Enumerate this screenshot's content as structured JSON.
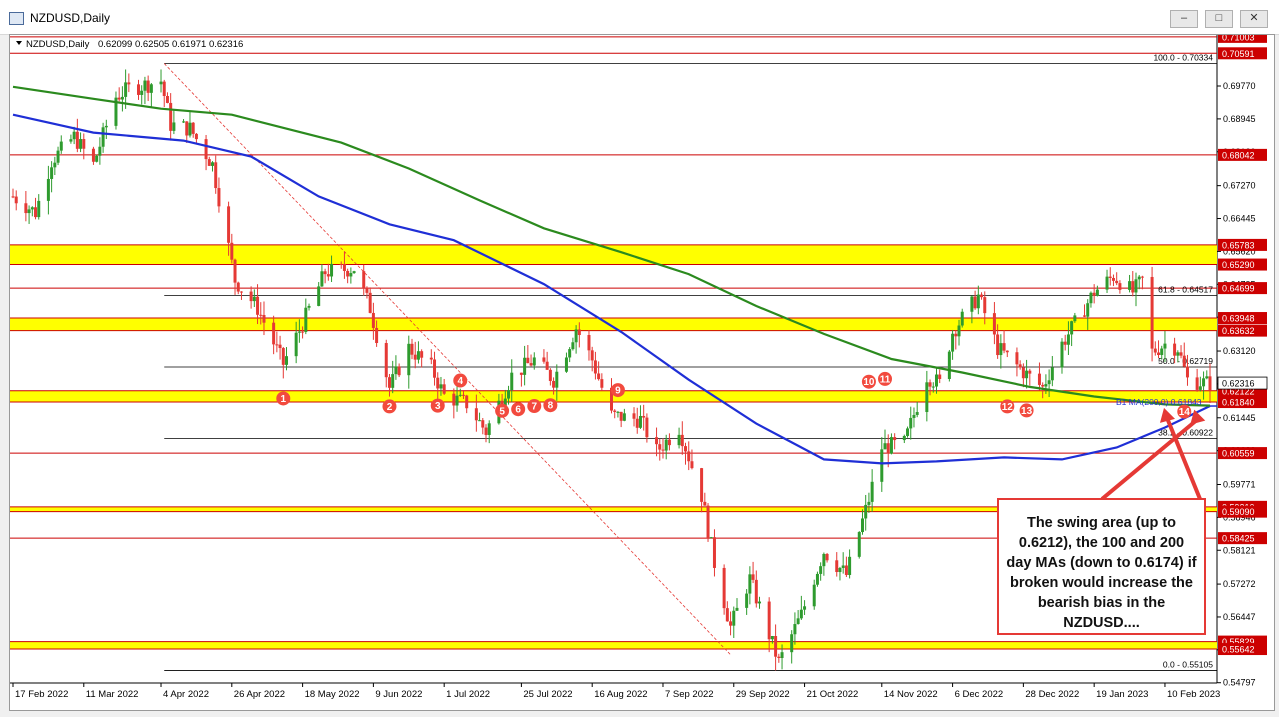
{
  "window": {
    "title": "NZDUSD,Daily",
    "min_label": "–",
    "max_label": "□",
    "close_label": "✕"
  },
  "header": {
    "symbol": "NZDUSD,Daily",
    "ohlc": "0.62099 0.62505 0.61971 0.62316"
  },
  "annotation": {
    "text": "The swing area (up to 0.6212), the 100 and 200 day MAs (down to 0.6174) if broken would increase the bearish bias in the NZDUSD...."
  },
  "colors": {
    "bull": "#2e9b2e",
    "bear": "#e53935",
    "zone": "#ffff00",
    "ma100": "#1f2fd6",
    "ma200": "#2b8a1e",
    "level": "#cc0000"
  },
  "chart_data": {
    "type": "candlestick",
    "title": "NZDUSD,Daily",
    "ylim": [
      0.5479,
      0.7105
    ],
    "x_start": "2022-02-17",
    "x_end": "2023-02-24",
    "x_ticks": [
      "17 Feb 2022",
      "11 Mar 2022",
      "4 Apr 2022",
      "26 Apr 2022",
      "18 May 2022",
      "9 Jun 2022",
      "1 Jul 2022",
      "25 Jul 2022",
      "16 Aug 2022",
      "7 Sep 2022",
      "29 Sep 2022",
      "21 Oct 2022",
      "14 Nov 2022",
      "6 Dec 2022",
      "28 Dec 2022",
      "19 Jan 2023",
      "10 Feb 2023"
    ],
    "x_tick_dates": [
      "2022-02-17",
      "2022-03-11",
      "2022-04-04",
      "2022-04-26",
      "2022-05-18",
      "2022-06-09",
      "2022-07-01",
      "2022-07-25",
      "2022-08-16",
      "2022-09-07",
      "2022-09-29",
      "2022-10-21",
      "2022-11-14",
      "2022-12-06",
      "2022-12-28",
      "2023-01-19",
      "2023-02-10"
    ],
    "y_ticks": [
      "0.69770",
      "0.68945",
      "0.68120",
      "0.67270",
      "0.66445",
      "0.65620",
      "0.64795",
      "0.63970",
      "0.63120",
      "0.62295",
      "0.61445",
      "0.60620",
      "0.59771",
      "0.58946",
      "0.58121",
      "0.57272",
      "0.56447",
      "0.55622",
      "0.54797"
    ],
    "price_path": [
      [
        "2022-02-17",
        0.67
      ],
      [
        "2022-02-24",
        0.666
      ],
      [
        "2022-03-01",
        0.679
      ],
      [
        "2022-03-08",
        0.685
      ],
      [
        "2022-03-14",
        0.678
      ],
      [
        "2022-03-21",
        0.695
      ],
      [
        "2022-03-25",
        0.697
      ],
      [
        "2022-04-04",
        0.699
      ],
      [
        "2022-04-07",
        0.688
      ],
      [
        "2022-04-13",
        0.687
      ],
      [
        "2022-04-20",
        0.678
      ],
      [
        "2022-04-27",
        0.649
      ],
      [
        "2022-05-04",
        0.642
      ],
      [
        "2022-05-12",
        0.628
      ],
      [
        "2022-05-18",
        0.638
      ],
      [
        "2022-05-25",
        0.651
      ],
      [
        "2022-06-03",
        0.652
      ],
      [
        "2022-06-08",
        0.642
      ],
      [
        "2022-06-14",
        0.622
      ],
      [
        "2022-06-20",
        0.632
      ],
      [
        "2022-06-27",
        0.627
      ],
      [
        "2022-07-01",
        0.62
      ],
      [
        "2022-07-08",
        0.618
      ],
      [
        "2022-07-14",
        0.611
      ],
      [
        "2022-07-22",
        0.625
      ],
      [
        "2022-07-29",
        0.629
      ],
      [
        "2022-08-04",
        0.624
      ],
      [
        "2022-08-11",
        0.637
      ],
      [
        "2022-08-16",
        0.629
      ],
      [
        "2022-08-22",
        0.615
      ],
      [
        "2022-08-31",
        0.614
      ],
      [
        "2022-09-05",
        0.606
      ],
      [
        "2022-09-12",
        0.612
      ],
      [
        "2022-09-19",
        0.595
      ],
      [
        "2022-09-23",
        0.578
      ],
      [
        "2022-09-28",
        0.562
      ],
      [
        "2022-10-04",
        0.574
      ],
      [
        "2022-10-10",
        0.56
      ],
      [
        "2022-10-13",
        0.553
      ],
      [
        "2022-10-20",
        0.565
      ],
      [
        "2022-10-27",
        0.581
      ],
      [
        "2022-11-03",
        0.575
      ],
      [
        "2022-11-10",
        0.594
      ],
      [
        "2022-11-14",
        0.607
      ],
      [
        "2022-11-21",
        0.608
      ],
      [
        "2022-11-28",
        0.625
      ],
      [
        "2022-12-02",
        0.623
      ],
      [
        "2022-12-06",
        0.636
      ],
      [
        "2022-12-14",
        0.645
      ],
      [
        "2022-12-20",
        0.632
      ],
      [
        "2022-12-28",
        0.626
      ],
      [
        "2023-01-03",
        0.622
      ],
      [
        "2023-01-09",
        0.633
      ],
      [
        "2023-01-13",
        0.638
      ],
      [
        "2023-01-19",
        0.646
      ],
      [
        "2023-01-25",
        0.65
      ],
      [
        "2023-01-31",
        0.646
      ],
      [
        "2023-02-03",
        0.649
      ],
      [
        "2023-02-06",
        0.631
      ],
      [
        "2023-02-10",
        0.633
      ],
      [
        "2023-02-14",
        0.632
      ],
      [
        "2023-02-17",
        0.624
      ],
      [
        "2023-02-24",
        0.623
      ]
    ],
    "ma100": [
      [
        "2022-02-17",
        0.6905
      ],
      [
        "2022-03-14",
        0.686
      ],
      [
        "2022-04-11",
        0.684
      ],
      [
        "2022-05-02",
        0.68
      ],
      [
        "2022-05-23",
        0.67
      ],
      [
        "2022-06-14",
        0.663
      ],
      [
        "2022-07-04",
        0.659
      ],
      [
        "2022-08-01",
        0.648
      ],
      [
        "2022-08-25",
        0.636
      ],
      [
        "2022-09-15",
        0.624
      ],
      [
        "2022-10-06",
        0.613
      ],
      [
        "2022-10-27",
        0.604
      ],
      [
        "2022-11-14",
        0.603
      ],
      [
        "2022-12-01",
        0.6035
      ],
      [
        "2022-12-22",
        0.6045
      ],
      [
        "2023-01-09",
        0.604
      ],
      [
        "2023-01-26",
        0.607
      ],
      [
        "2023-02-10",
        0.612
      ],
      [
        "2023-02-24",
        0.6174
      ]
    ],
    "ma200": [
      [
        "2022-02-17",
        0.6975
      ],
      [
        "2022-03-14",
        0.6945
      ],
      [
        "2022-04-04",
        0.692
      ],
      [
        "2022-04-26",
        0.6905
      ],
      [
        "2022-05-30",
        0.6835
      ],
      [
        "2022-06-20",
        0.677
      ],
      [
        "2022-07-12",
        0.669
      ],
      [
        "2022-08-01",
        0.662
      ],
      [
        "2022-08-25",
        0.656
      ],
      [
        "2022-09-15",
        0.6505
      ],
      [
        "2022-10-06",
        0.6425
      ],
      [
        "2022-10-27",
        0.6355
      ],
      [
        "2022-11-17",
        0.6292
      ],
      [
        "2022-12-09",
        0.6258
      ],
      [
        "2022-12-30",
        0.6222
      ],
      [
        "2023-01-19",
        0.6198
      ],
      [
        "2023-02-10",
        0.6178
      ],
      [
        "2023-02-24",
        0.6175
      ]
    ],
    "fibonacci": [
      {
        "label": "100.0 - 0.70334",
        "value": 0.70334
      },
      {
        "label": "61.8 - 0.64517",
        "value": 0.64517
      },
      {
        "label": "50.0 - 0.62719",
        "value": 0.62719
      },
      {
        "label": "38.2 - 0.60922",
        "value": 0.60922
      },
      {
        "label": "0.0 - 0.55105",
        "value": 0.55105
      }
    ],
    "fib_start_date": "2022-04-05",
    "swing_zones": [
      [
        0.6529,
        0.65783
      ],
      [
        0.63632,
        0.63948
      ],
      [
        0.6184,
        0.62122
      ],
      [
        0.5909,
        0.5921
      ],
      [
        0.55642,
        0.55829
      ]
    ],
    "red_levels": [
      {
        "label": "0.71003",
        "value": 0.71003
      },
      {
        "label": "0.70591",
        "value": 0.70591
      },
      {
        "label": "0.68042",
        "value": 0.68042
      },
      {
        "label": "0.65783",
        "value": 0.65783
      },
      {
        "label": "0.65290",
        "value": 0.6529
      },
      {
        "label": "0.64699",
        "value": 0.64699
      },
      {
        "label": "0.63948",
        "value": 0.63948
      },
      {
        "label": "0.63632",
        "value": 0.63632
      },
      {
        "label": "0.62122",
        "value": 0.62122
      },
      {
        "label": "0.61840",
        "value": 0.6184
      },
      {
        "label": "0.60559",
        "value": 0.60559
      },
      {
        "label": "0.59210",
        "value": 0.5921
      },
      {
        "label": "0.59090",
        "value": 0.5909
      },
      {
        "label": "0.58425",
        "value": 0.58425
      },
      {
        "label": "0.55829",
        "value": 0.55829
      },
      {
        "label": "0.55642",
        "value": 0.55642
      }
    ],
    "current_price": {
      "label": "0.62316",
      "value": 0.62316
    },
    "ma_label": "B1 MA(200,0) 0.61843",
    "ma_label_value": 0.61843,
    "trendline": {
      "from": [
        "2022-04-05",
        0.70334
      ],
      "to": [
        "2022-09-28",
        0.555
      ]
    },
    "markers": [
      {
        "n": "1",
        "date": "2022-05-12",
        "price": 0.6193
      },
      {
        "n": "2",
        "date": "2022-06-14",
        "price": 0.6173
      },
      {
        "n": "3",
        "date": "2022-06-29",
        "price": 0.6175
      },
      {
        "n": "4",
        "date": "2022-07-06",
        "price": 0.6238
      },
      {
        "n": "5",
        "date": "2022-07-19",
        "price": 0.6162
      },
      {
        "n": "6",
        "date": "2022-07-24",
        "price": 0.6166
      },
      {
        "n": "7",
        "date": "2022-07-29",
        "price": 0.6174
      },
      {
        "n": "8",
        "date": "2022-08-03",
        "price": 0.6176
      },
      {
        "n": "9",
        "date": "2022-08-24",
        "price": 0.6214
      },
      {
        "n": "10",
        "date": "2022-11-10",
        "price": 0.6235
      },
      {
        "n": "11",
        "date": "2022-11-15",
        "price": 0.6242
      },
      {
        "n": "12",
        "date": "2022-12-23",
        "price": 0.6173
      },
      {
        "n": "13",
        "date": "2022-12-29",
        "price": 0.6163
      },
      {
        "n": "14",
        "date": "2023-02-16",
        "price": 0.616
      }
    ]
  }
}
